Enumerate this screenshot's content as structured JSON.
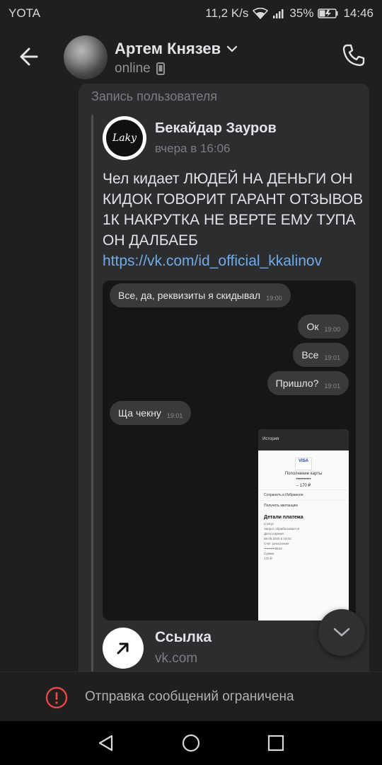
{
  "statusbar": {
    "carrier": "YOTA",
    "net_speed": "11,2 K/s",
    "battery": "35%",
    "time": "14:46"
  },
  "header": {
    "name": "Артем Князев",
    "status": "online"
  },
  "message": {
    "repost_label": "Запись пользователя",
    "author_name": "Бекайдар Зауров",
    "author_avatar_text": "Laky",
    "author_time": "вчера в 16:06",
    "text": "Чел кидает ЛЮДЕЙ НА ДЕНЬГИ ОН КИДОК ГОВОРИТ ГАРАНТ ОТЗЫВОВ 1К НАКРУТКА НЕ ВЕРТЕ ЕМУ ТУПА ОН ДАЛБАЕБ",
    "link": "https://vk.com/id_official_kkalinov",
    "attachment": {
      "bubbles": [
        {
          "text": "Все, да, реквизиты я скидывал",
          "time": "19:00"
        },
        {
          "text": "Ок",
          "time": "19:00"
        },
        {
          "text": "Все",
          "time": "19:01"
        },
        {
          "text": "Пришло?",
          "time": "19:01"
        },
        {
          "text": "Ща чекну",
          "time": "19:01"
        }
      ],
      "phone": {
        "top_title": "История",
        "logo": "VISA",
        "heading": "Пополнение карты",
        "masked": "••••••••••",
        "amount": "– 170 ₽",
        "action_save": "Сохранить в Избранное",
        "action_receipt": "Получить квитанцию",
        "details_title": "Детали платежа",
        "status_label": "Статус",
        "status_value": "Запрос обрабатывается",
        "date_label": "Дата и время",
        "date_value": "08.05.2020 в 19:02",
        "account_label": "Счёт зачисления",
        "account_value": "••••••••••0642",
        "sum_label": "Сумма",
        "sum_value": "170 ₽"
      }
    },
    "link_preview": {
      "title": "Ссылка",
      "domain": "vk.com"
    }
  },
  "footer": {
    "restricted_text": "Отправка сообщений ограничена"
  }
}
